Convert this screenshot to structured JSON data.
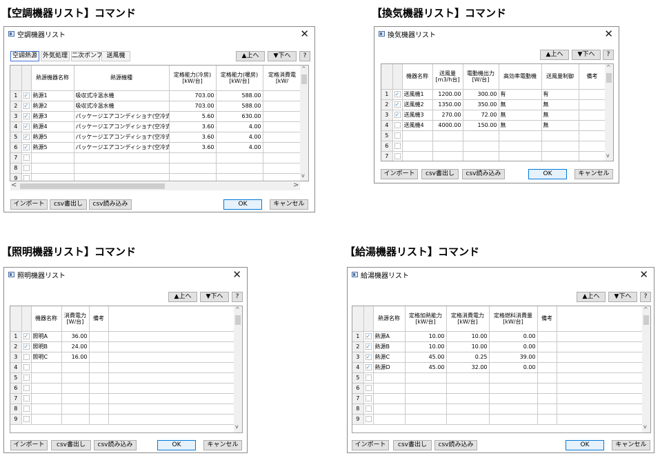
{
  "captions": {
    "ac": "【空調機器リスト】コマンド",
    "vent": "【換気機器リスト】コマンド",
    "light": "【照明機器リスト】コマンド",
    "hw": "【給湯機器リスト】コマンド"
  },
  "common": {
    "close": "✕",
    "up": "▲上へ",
    "down": "▼下へ",
    "help": "?",
    "import": "インポート",
    "export": "csv書出し",
    "csvread": "csv読み込み",
    "ok": "OK",
    "cancel": "キャンセル",
    "check": "✓",
    "arrow_up": "^",
    "arrow_down": "v",
    "arrow_left": "<",
    "arrow_right": ">"
  },
  "ac": {
    "title": "空調機器リスト",
    "tabs": [
      "空調熱源",
      "外気処理",
      "二次ポンプ",
      "送風機"
    ],
    "headers": [
      "熱源機器名称",
      "熱源機種",
      "定格能力(冷房)\n[kW/台]",
      "定格能力(暖房)\n[kW/台]",
      "定格消費電\n[kW/"
    ],
    "rows": [
      {
        "n": "1",
        "c": true,
        "name": "熱源1",
        "type": "吸収式冷温水機",
        "cool": "703.00",
        "heat": "588.00"
      },
      {
        "n": "2",
        "c": true,
        "name": "熱源2",
        "type": "吸収式冷温水機",
        "cool": "703.00",
        "heat": "588.00"
      },
      {
        "n": "3",
        "c": true,
        "name": "熱源3",
        "type": "パッケージエアコンディショナ(空冷式)",
        "cool": "5.60",
        "heat": "630.00"
      },
      {
        "n": "4",
        "c": true,
        "name": "熱源4",
        "type": "パッケージエアコンディショナ(空冷式)",
        "cool": "3.60",
        "heat": "4.00"
      },
      {
        "n": "5",
        "c": true,
        "name": "熱源5",
        "type": "パッケージエアコンディショナ(空冷式)",
        "cool": "3.60",
        "heat": "4.00"
      },
      {
        "n": "6",
        "c": true,
        "name": "熱源5",
        "type": "パッケージエアコンディショナ(空冷式)",
        "cool": "3.60",
        "heat": "4.00"
      },
      {
        "n": "7",
        "c": false,
        "name": "",
        "type": "",
        "cool": "",
        "heat": ""
      },
      {
        "n": "8",
        "c": false,
        "name": "",
        "type": "",
        "cool": "",
        "heat": ""
      },
      {
        "n": "9",
        "c": false,
        "name": "",
        "type": "",
        "cool": "",
        "heat": ""
      }
    ]
  },
  "vent": {
    "title": "換気機器リスト",
    "headers": [
      "機器名称",
      "送風量\n[m3/h台]",
      "電動機出力\n[W/台]",
      "高効率電動機",
      "送風量制御",
      "備考"
    ],
    "rows": [
      {
        "n": "1",
        "c": true,
        "name": "送風機1",
        "flow": "1200.00",
        "power": "300.00",
        "eff": "有",
        "ctrl": "有"
      },
      {
        "n": "2",
        "c": true,
        "name": "送風機2",
        "flow": "1350.00",
        "power": "350.00",
        "eff": "無",
        "ctrl": "無"
      },
      {
        "n": "3",
        "c": true,
        "name": "送風機3",
        "flow": "270.00",
        "power": "72.00",
        "eff": "無",
        "ctrl": "無"
      },
      {
        "n": "4",
        "c": false,
        "name": "送風機4",
        "flow": "4000.00",
        "power": "150.00",
        "eff": "無",
        "ctrl": "無"
      },
      {
        "n": "5",
        "c": false,
        "name": "",
        "flow": "",
        "power": "",
        "eff": "",
        "ctrl": ""
      },
      {
        "n": "6",
        "c": false,
        "name": "",
        "flow": "",
        "power": "",
        "eff": "",
        "ctrl": ""
      },
      {
        "n": "7",
        "c": false,
        "name": "",
        "flow": "",
        "power": "",
        "eff": "",
        "ctrl": ""
      }
    ]
  },
  "light": {
    "title": "照明機器リスト",
    "headers": [
      "機器名称",
      "消費電力\n[W/台]",
      "備考"
    ],
    "rows": [
      {
        "n": "1",
        "c": true,
        "name": "照明A",
        "power": "36.00"
      },
      {
        "n": "2",
        "c": true,
        "name": "照明B",
        "power": "24.00"
      },
      {
        "n": "3",
        "c": false,
        "name": "照明C",
        "power": "16.00"
      },
      {
        "n": "4",
        "c": false,
        "name": "",
        "power": ""
      },
      {
        "n": "5",
        "c": false,
        "name": "",
        "power": ""
      },
      {
        "n": "6",
        "c": false,
        "name": "",
        "power": ""
      },
      {
        "n": "7",
        "c": false,
        "name": "",
        "power": ""
      },
      {
        "n": "8",
        "c": false,
        "name": "",
        "power": ""
      },
      {
        "n": "9",
        "c": false,
        "name": "",
        "power": ""
      }
    ]
  },
  "hw": {
    "title": "給湯機器リスト",
    "headers": [
      "熱源名称",
      "定格加熱能力\n[kW/台]",
      "定格消費電力\n[kW/台]",
      "定格燃料消費量\n[kW/台]",
      "備考"
    ],
    "rows": [
      {
        "n": "1",
        "c": true,
        "name": "熱源A",
        "heat": "10.00",
        "elec": "10.00",
        "fuel": "0.00"
      },
      {
        "n": "2",
        "c": true,
        "name": "熱源B",
        "heat": "10.00",
        "elec": "10.00",
        "fuel": "0.00"
      },
      {
        "n": "3",
        "c": true,
        "name": "熱源C",
        "heat": "45.00",
        "elec": "0.25",
        "fuel": "39.00"
      },
      {
        "n": "4",
        "c": true,
        "name": "熱源D",
        "heat": "45.00",
        "elec": "32.00",
        "fuel": "0.00"
      },
      {
        "n": "5",
        "c": false,
        "name": "",
        "heat": "",
        "elec": "",
        "fuel": ""
      },
      {
        "n": "6",
        "c": false,
        "name": "",
        "heat": "",
        "elec": "",
        "fuel": ""
      },
      {
        "n": "7",
        "c": false,
        "name": "",
        "heat": "",
        "elec": "",
        "fuel": ""
      },
      {
        "n": "8",
        "c": false,
        "name": "",
        "heat": "",
        "elec": "",
        "fuel": ""
      },
      {
        "n": "9",
        "c": false,
        "name": "",
        "heat": "",
        "elec": "",
        "fuel": ""
      }
    ]
  }
}
